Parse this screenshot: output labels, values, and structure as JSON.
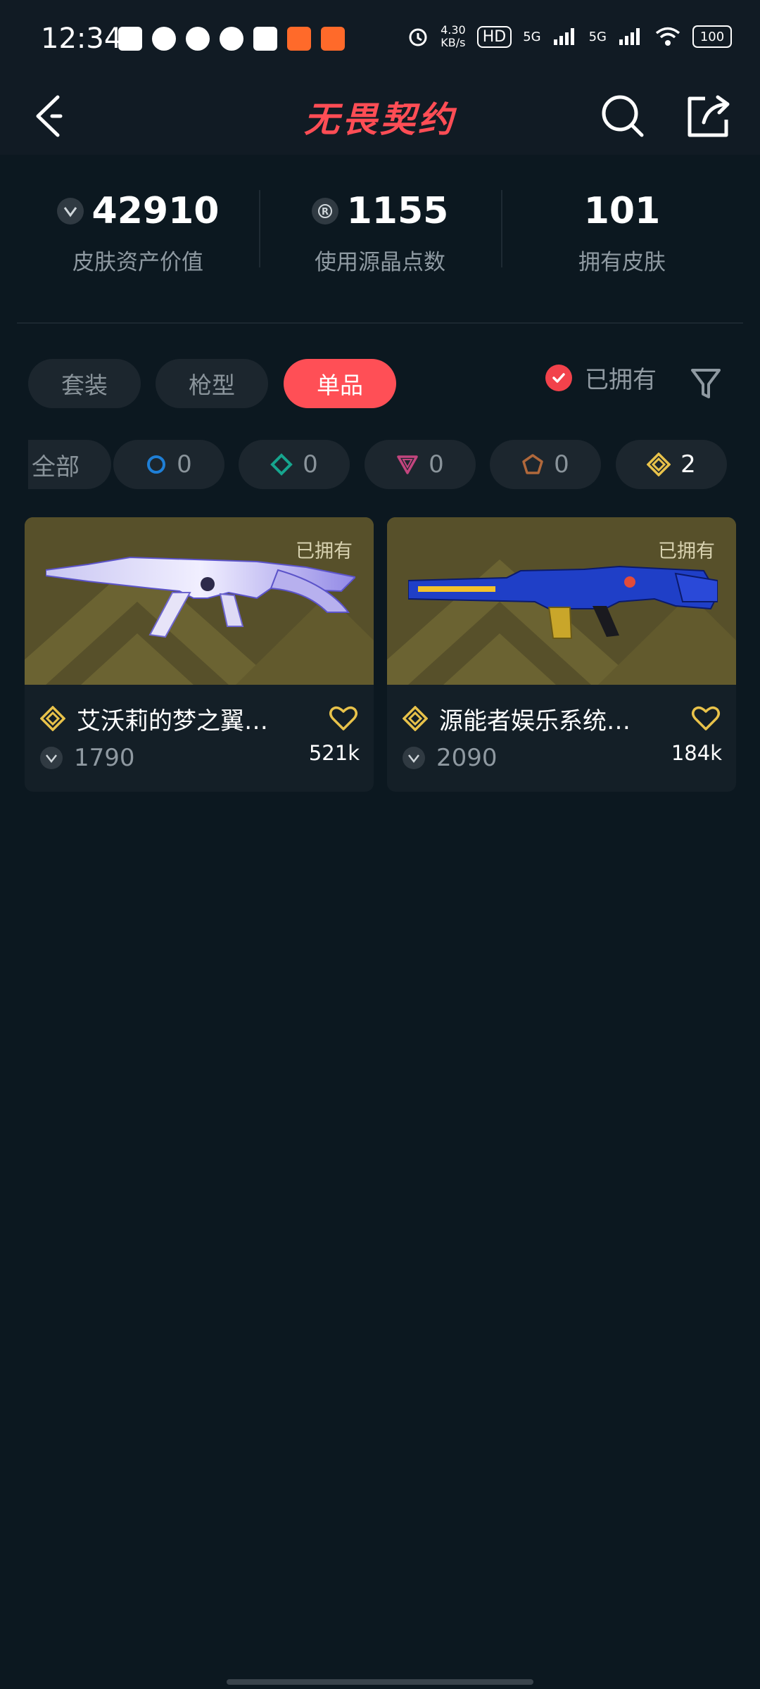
{
  "status_bar": {
    "time": "12:34",
    "net_speed_value": "4.30",
    "net_speed_unit": "KB/s",
    "hd_label": "HD",
    "signal_1": "5G",
    "signal_2": "5G",
    "battery": "100"
  },
  "header": {
    "title": "无畏契约",
    "back_icon": "back-arrow-icon",
    "search_icon": "search-icon",
    "share_icon": "share-icon"
  },
  "stats": [
    {
      "value": "42910",
      "label": "皮肤资产价值",
      "icon": "vp-icon"
    },
    {
      "value": "1155",
      "label": "使用源晶点数",
      "icon": "radianite-icon"
    },
    {
      "value": "101",
      "label": "拥有皮肤"
    }
  ],
  "tabs": [
    {
      "label": "套装",
      "active": false
    },
    {
      "label": "枪型",
      "active": false
    },
    {
      "label": "单品",
      "active": true
    }
  ],
  "owned_filter": {
    "label": "已拥有",
    "checked": true
  },
  "tier_chips": [
    {
      "label": "全部",
      "count": ""
    },
    {
      "count": "0",
      "icon": "select-tier-icon",
      "color": "#1f7fd6"
    },
    {
      "count": "0",
      "icon": "deluxe-tier-icon",
      "color": "#16a58e"
    },
    {
      "count": "0",
      "icon": "premium-tier-icon",
      "color": "#c2457e"
    },
    {
      "count": "0",
      "icon": "exclusive-tier-icon",
      "color": "#b0683b"
    },
    {
      "count": "2",
      "icon": "ultra-tier-icon",
      "color": "#e8c24a"
    }
  ],
  "skins": [
    {
      "owned_label": "已拥有",
      "name": "艾沃莉的梦之翼…",
      "price": "1790",
      "likes": "521k"
    },
    {
      "owned_label": "已拥有",
      "name": "源能者娱乐系统…",
      "price": "2090",
      "likes": "184k"
    }
  ],
  "colors": {
    "accent": "#ff4f56",
    "background": "#0c1820",
    "gold": "#e8c24a"
  }
}
